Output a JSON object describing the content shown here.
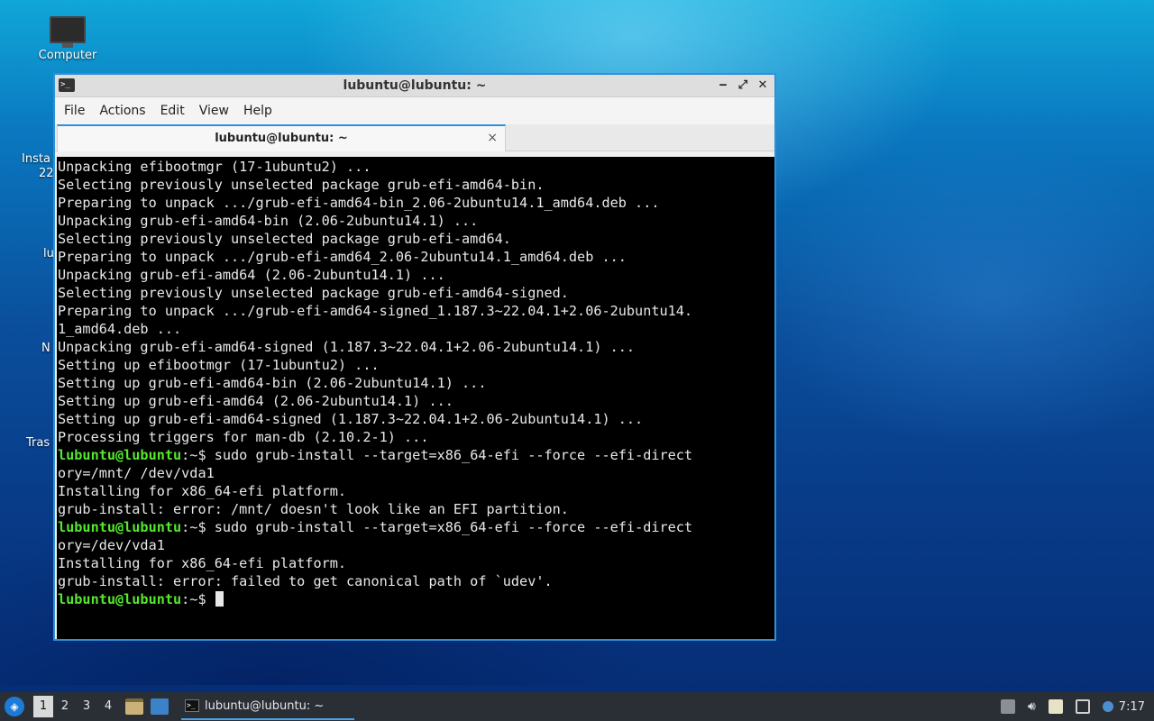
{
  "desktop": {
    "icons": [
      {
        "label": "Computer"
      },
      {
        "label": "Insta"
      },
      {
        "label": "22"
      },
      {
        "label": "lu"
      },
      {
        "label": "N"
      },
      {
        "label": "Tras"
      }
    ]
  },
  "window": {
    "title": "lubuntu@lubuntu: ~",
    "controls": {
      "minimize": "‒",
      "maximize": "⤢",
      "close": "✕"
    },
    "menu": [
      "File",
      "Actions",
      "Edit",
      "View",
      "Help"
    ],
    "tab": {
      "label": "lubuntu@lubuntu: ~",
      "close": "×"
    }
  },
  "terminal": {
    "prompt_user": "lubuntu@lubuntu",
    "prompt_path": ":~$",
    "lines": [
      {
        "type": "out",
        "text": "Unpacking efibootmgr (17-1ubuntu2) ..."
      },
      {
        "type": "out",
        "text": "Selecting previously unselected package grub-efi-amd64-bin."
      },
      {
        "type": "out",
        "text": "Preparing to unpack .../grub-efi-amd64-bin_2.06-2ubuntu14.1_amd64.deb ..."
      },
      {
        "type": "out",
        "text": "Unpacking grub-efi-amd64-bin (2.06-2ubuntu14.1) ..."
      },
      {
        "type": "out",
        "text": "Selecting previously unselected package grub-efi-amd64."
      },
      {
        "type": "out",
        "text": "Preparing to unpack .../grub-efi-amd64_2.06-2ubuntu14.1_amd64.deb ..."
      },
      {
        "type": "out",
        "text": "Unpacking grub-efi-amd64 (2.06-2ubuntu14.1) ..."
      },
      {
        "type": "out",
        "text": "Selecting previously unselected package grub-efi-amd64-signed."
      },
      {
        "type": "out",
        "text": "Preparing to unpack .../grub-efi-amd64-signed_1.187.3~22.04.1+2.06-2ubuntu14."
      },
      {
        "type": "out",
        "text": "1_amd64.deb ..."
      },
      {
        "type": "out",
        "text": "Unpacking grub-efi-amd64-signed (1.187.3~22.04.1+2.06-2ubuntu14.1) ..."
      },
      {
        "type": "out",
        "text": "Setting up efibootmgr (17-1ubuntu2) ..."
      },
      {
        "type": "out",
        "text": "Setting up grub-efi-amd64-bin (2.06-2ubuntu14.1) ..."
      },
      {
        "type": "out",
        "text": "Setting up grub-efi-amd64 (2.06-2ubuntu14.1) ..."
      },
      {
        "type": "out",
        "text": "Setting up grub-efi-amd64-signed (1.187.3~22.04.1+2.06-2ubuntu14.1) ..."
      },
      {
        "type": "out",
        "text": "Processing triggers for man-db (2.10.2-1) ..."
      },
      {
        "type": "cmd",
        "text": " sudo grub-install --target=x86_64-efi --force --efi-direct"
      },
      {
        "type": "out",
        "text": "ory=/mnt/ /dev/vda1"
      },
      {
        "type": "out",
        "text": "Installing for x86_64-efi platform."
      },
      {
        "type": "out",
        "text": "grub-install: error: /mnt/ doesn't look like an EFI partition."
      },
      {
        "type": "cmd",
        "text": " sudo grub-install --target=x86_64-efi --force --efi-direct"
      },
      {
        "type": "out",
        "text": "ory=/dev/vda1"
      },
      {
        "type": "out",
        "text": "Installing for x86_64-efi platform."
      },
      {
        "type": "out",
        "text": "grub-install: error: failed to get canonical path of `udev'."
      },
      {
        "type": "cmd",
        "text": " "
      }
    ]
  },
  "taskbar": {
    "workspaces": [
      "1",
      "2",
      "3",
      "4"
    ],
    "active_workspace": "1",
    "task_label": "lubuntu@lubuntu: ~",
    "clock": "7:17"
  }
}
